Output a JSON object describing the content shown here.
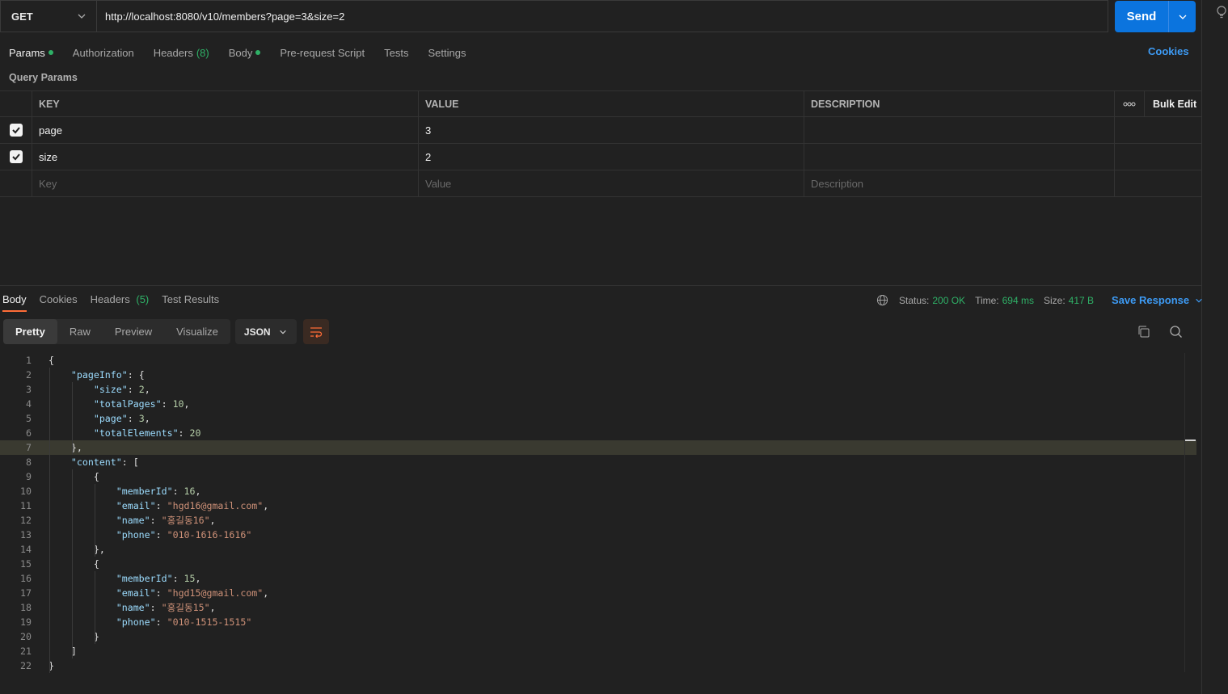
{
  "request": {
    "method": "GET",
    "url": "http://localhost:8080/v10/members?page=3&size=2",
    "send_label": "Send"
  },
  "tabs": {
    "params": "Params",
    "authorization": "Authorization",
    "headers": "Headers",
    "headers_count": "(8)",
    "body": "Body",
    "prerequest": "Pre-request Script",
    "tests": "Tests",
    "settings": "Settings",
    "cookies": "Cookies"
  },
  "query_params": {
    "title": "Query Params",
    "columns": {
      "key": "KEY",
      "value": "VALUE",
      "description": "DESCRIPTION",
      "bulk_edit": "Bulk Edit"
    },
    "rows": [
      {
        "key": "page",
        "value": "3",
        "checked": true
      },
      {
        "key": "size",
        "value": "2",
        "checked": true
      }
    ],
    "placeholders": {
      "key": "Key",
      "value": "Value",
      "description": "Description"
    }
  },
  "response": {
    "tabs": {
      "body": "Body",
      "cookies": "Cookies",
      "headers": "Headers",
      "headers_count": "(5)",
      "test_results": "Test Results"
    },
    "status_label": "Status:",
    "status_value": "200 OK",
    "time_label": "Time:",
    "time_value": "694 ms",
    "size_label": "Size:",
    "size_value": "417 B",
    "save_response": "Save Response",
    "views": {
      "pretty": "Pretty",
      "raw": "Raw",
      "preview": "Preview",
      "visualize": "Visualize"
    },
    "format": "JSON"
  },
  "code_lines": [
    {
      "n": "1",
      "text": "{"
    },
    {
      "n": "2",
      "text": "    \"pageInfo\": {"
    },
    {
      "n": "3",
      "text": "        \"size\": 2,"
    },
    {
      "n": "4",
      "text": "        \"totalPages\": 10,"
    },
    {
      "n": "5",
      "text": "        \"page\": 3,"
    },
    {
      "n": "6",
      "text": "        \"totalElements\": 20"
    },
    {
      "n": "7",
      "text": "    },"
    },
    {
      "n": "8",
      "text": "    \"content\": ["
    },
    {
      "n": "9",
      "text": "        {"
    },
    {
      "n": "10",
      "text": "            \"memberId\": 16,"
    },
    {
      "n": "11",
      "text": "            \"email\": \"hgd16@gmail.com\","
    },
    {
      "n": "12",
      "text": "            \"name\": \"홍길동16\","
    },
    {
      "n": "13",
      "text": "            \"phone\": \"010-1616-1616\""
    },
    {
      "n": "14",
      "text": "        },"
    },
    {
      "n": "15",
      "text": "        {"
    },
    {
      "n": "16",
      "text": "            \"memberId\": 15,"
    },
    {
      "n": "17",
      "text": "            \"email\": \"hgd15@gmail.com\","
    },
    {
      "n": "18",
      "text": "            \"name\": \"홍길동15\","
    },
    {
      "n": "19",
      "text": "            \"phone\": \"010-1515-1515\""
    },
    {
      "n": "20",
      "text": "        }"
    },
    {
      "n": "21",
      "text": "    ]"
    },
    {
      "n": "22",
      "text": "}"
    }
  ],
  "highlighted_line": 7,
  "colors": {
    "accent": "#ff6c37",
    "send": "#0b74de",
    "success": "#2fb167",
    "link": "#3d9bf5"
  }
}
